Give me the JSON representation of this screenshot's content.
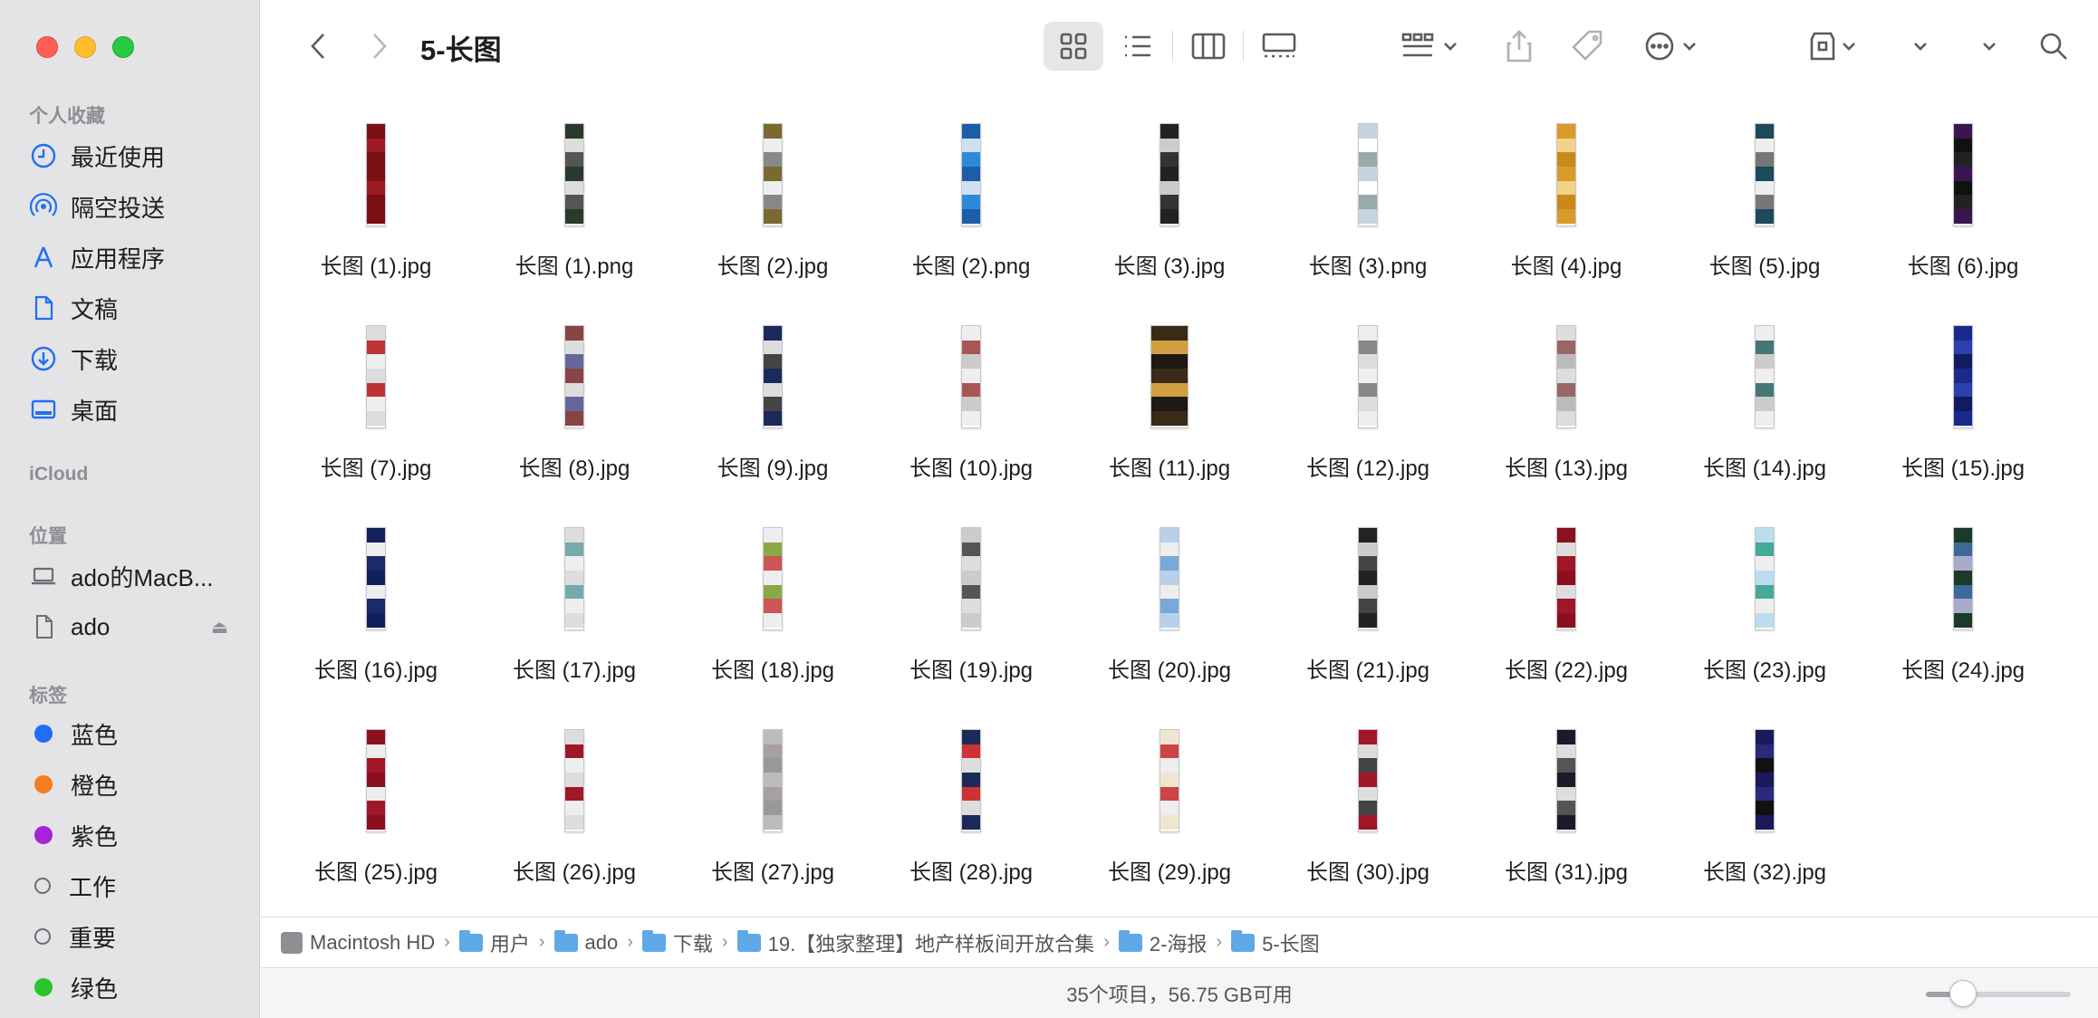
{
  "window": {
    "title": "5-长图"
  },
  "sidebar": {
    "favorites_header": "个人收藏",
    "favorites": [
      {
        "label": "最近使用",
        "icon": "clock-icon"
      },
      {
        "label": "隔空投送",
        "icon": "airdrop-icon"
      },
      {
        "label": "应用程序",
        "icon": "applications-icon"
      },
      {
        "label": "文稿",
        "icon": "document-icon"
      },
      {
        "label": "下载",
        "icon": "download-icon"
      },
      {
        "label": "桌面",
        "icon": "desktop-icon"
      }
    ],
    "icloud_header": "iCloud",
    "locations_header": "位置",
    "locations": [
      {
        "label": "ado的MacB...",
        "icon": "laptop-icon"
      },
      {
        "label": "ado",
        "icon": "file-icon"
      }
    ],
    "tags_header": "标签",
    "tags": [
      {
        "label": "蓝色",
        "color": "#1f6ff5"
      },
      {
        "label": "橙色",
        "color": "#f57c1f"
      },
      {
        "label": "紫色",
        "color": "#a524d6"
      },
      {
        "label": "工作",
        "color": ""
      },
      {
        "label": "重要",
        "color": ""
      },
      {
        "label": "绿色",
        "color": "#2bc52b"
      }
    ]
  },
  "files": [
    {
      "name": "长图 (1).jpg",
      "colors": [
        "#7a0f15",
        "#9c1b22",
        "#7a0f15"
      ]
    },
    {
      "name": "长图 (1).png",
      "colors": [
        "#2a3a2a",
        "#ddd",
        "#555"
      ]
    },
    {
      "name": "长图 (2).jpg",
      "colors": [
        "#7a6a30",
        "#eee",
        "#888"
      ]
    },
    {
      "name": "长图 (2).png",
      "colors": [
        "#1b5ea6",
        "#cfe0f0",
        "#2e8ad8"
      ]
    },
    {
      "name": "长图 (3).jpg",
      "colors": [
        "#222",
        "#ccc",
        "#333"
      ]
    },
    {
      "name": "长图 (3).png",
      "colors": [
        "#c7d3df",
        "#fff",
        "#9aa"
      ]
    },
    {
      "name": "长图 (4).jpg",
      "colors": [
        "#d99b2b",
        "#f0d28a",
        "#c98a1a"
      ]
    },
    {
      "name": "长图 (5).jpg",
      "colors": [
        "#1c4a5a",
        "#eee",
        "#777"
      ]
    },
    {
      "name": "长图 (6).jpg",
      "colors": [
        "#3a1650",
        "#111",
        "#222"
      ]
    },
    {
      "name": "长图 (7).jpg",
      "colors": [
        "#ddd",
        "#b33",
        "#eee"
      ]
    },
    {
      "name": "长图 (8).jpg",
      "colors": [
        "#844",
        "#ddd",
        "#669"
      ]
    },
    {
      "name": "长图 (9).jpg",
      "colors": [
        "#1a2a5a",
        "#ddd",
        "#444"
      ]
    },
    {
      "name": "长图 (10).jpg",
      "colors": [
        "#eee",
        "#a55",
        "#ccc"
      ]
    },
    {
      "name": "长图 (11).jpg",
      "colors": [
        "#3a2a1a",
        "#d2a040",
        "#201812"
      ]
    },
    {
      "name": "长图 (12).jpg",
      "colors": [
        "#eee",
        "#888",
        "#ddd"
      ]
    },
    {
      "name": "长图 (13).jpg",
      "colors": [
        "#ddd",
        "#966",
        "#bbb"
      ]
    },
    {
      "name": "长图 (14).jpg",
      "colors": [
        "#eee",
        "#477",
        "#ccc"
      ]
    },
    {
      "name": "长图 (15).jpg",
      "colors": [
        "#1a2a8a",
        "#2b3fb0",
        "#121a60"
      ]
    },
    {
      "name": "长图 (16).jpg",
      "colors": [
        "#10205a",
        "#eee",
        "#1a2a6a"
      ]
    },
    {
      "name": "长图 (17).jpg",
      "colors": [
        "#ddd",
        "#7aa",
        "#eee"
      ]
    },
    {
      "name": "长图 (18).jpg",
      "colors": [
        "#eee",
        "#8a4",
        "#c55"
      ]
    },
    {
      "name": "长图 (19).jpg",
      "colors": [
        "#ccc",
        "#555",
        "#ddd"
      ]
    },
    {
      "name": "长图 (20).jpg",
      "colors": [
        "#b8d0ea",
        "#eee",
        "#7aa8d8"
      ]
    },
    {
      "name": "长图 (21).jpg",
      "colors": [
        "#222",
        "#ccc",
        "#444"
      ]
    },
    {
      "name": "长图 (22).jpg",
      "colors": [
        "#8a1020",
        "#ddd",
        "#a01828"
      ]
    },
    {
      "name": "长图 (23).jpg",
      "colors": [
        "#bde",
        "#4a9",
        "#eee"
      ]
    },
    {
      "name": "长图 (24).jpg",
      "colors": [
        "#1a3a2a",
        "#3a6a9a",
        "#aac"
      ]
    },
    {
      "name": "长图 (25).jpg",
      "colors": [
        "#8a1020",
        "#eee",
        "#a01828"
      ]
    },
    {
      "name": "长图 (26).jpg",
      "colors": [
        "#ddd",
        "#a01828",
        "#eee"
      ]
    },
    {
      "name": "长图 (27).jpg",
      "colors": [
        "#bbb",
        "#a8a0a0",
        "#999"
      ]
    },
    {
      "name": "长图 (28).jpg",
      "colors": [
        "#1a2a5a",
        "#c33",
        "#ddd"
      ]
    },
    {
      "name": "长图 (29).jpg",
      "colors": [
        "#f0e6d0",
        "#c44",
        "#eee"
      ]
    },
    {
      "name": "长图 (30).jpg",
      "colors": [
        "#a01828",
        "#ddd",
        "#444"
      ]
    },
    {
      "name": "长图 (31).jpg",
      "colors": [
        "#1a1a2a",
        "#ddd",
        "#555"
      ]
    },
    {
      "name": "长图 (32).jpg",
      "colors": [
        "#1a1a5a",
        "#2a2a7a",
        "#111"
      ]
    }
  ],
  "pathbar": [
    {
      "label": "Macintosh HD",
      "icon": "hard-drive-icon"
    },
    {
      "label": "用户",
      "icon": "folder-icon"
    },
    {
      "label": "ado",
      "icon": "home-folder-icon"
    },
    {
      "label": "下载",
      "icon": "downloads-folder-icon"
    },
    {
      "label": "19.【独家整理】地产样板间开放合集",
      "icon": "folder-icon"
    },
    {
      "label": "2-海报",
      "icon": "folder-icon"
    },
    {
      "label": "5-长图",
      "icon": "folder-icon"
    }
  ],
  "status": {
    "text": "35个项目，56.75 GB可用",
    "zoom_level": 0.2
  }
}
